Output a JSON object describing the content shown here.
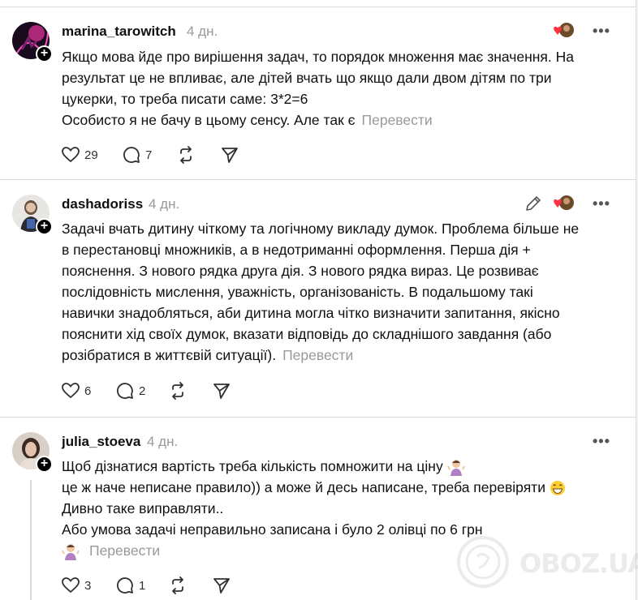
{
  "posts": [
    {
      "username": "marina_tarowitch",
      "time": "4 дн.",
      "lines": [
        "Якщо мова йде про вирішення задач, то порядок множення має значення. На",
        "результат це не впливає, але дітей вчать що якщо дали двом дітям по три",
        "цукерки, то треба писати саме: 3*2=6",
        "Особисто я не бачу в цьому сенсу. Але так є"
      ],
      "translate": "Перевести",
      "likes": "29",
      "replies": "7"
    },
    {
      "username": "dashadoriss",
      "time": "4 дн.",
      "lines": [
        "Задачі вчать дитину чіткому та логічному викладу думок. Проблема більше не",
        "в перестановці множників, а в недотриманні оформлення. Перша дія +",
        "пояснення. З нового рядка друга дія. З нового рядка вираз. Це розвиває",
        "послідовність мислення, уважність, організованість. В подальшому такі",
        "навички знадобляться, аби дитина могла чітко визначити запитання, якісно",
        "пояснити хід своїх думок, вказати відповідь до складнішого завдання (або",
        "розібратися в життєвій ситуації)."
      ],
      "translate": "Перевести",
      "likes": "6",
      "replies": "2"
    },
    {
      "username": "julia_stoeva",
      "time": "4 дн.",
      "lines": [
        "Щоб дізнатися вартість треба кількість помножити на ціну",
        "це ж наче неписане правило)) а може й десь написане, треба перевіряти",
        "Дивно таке виправляти..",
        "Або умова задачі неправильно записана і було 2 олівці по 6 грн"
      ],
      "translate": "Перевести",
      "likes": "3",
      "replies": "1"
    }
  ],
  "more_label": "•••",
  "watermark": "OBOZ.UA",
  "colors": {
    "text": "#101010",
    "muted": "#999999",
    "separator": "#dcdcdc",
    "heart": "#ff3040"
  }
}
